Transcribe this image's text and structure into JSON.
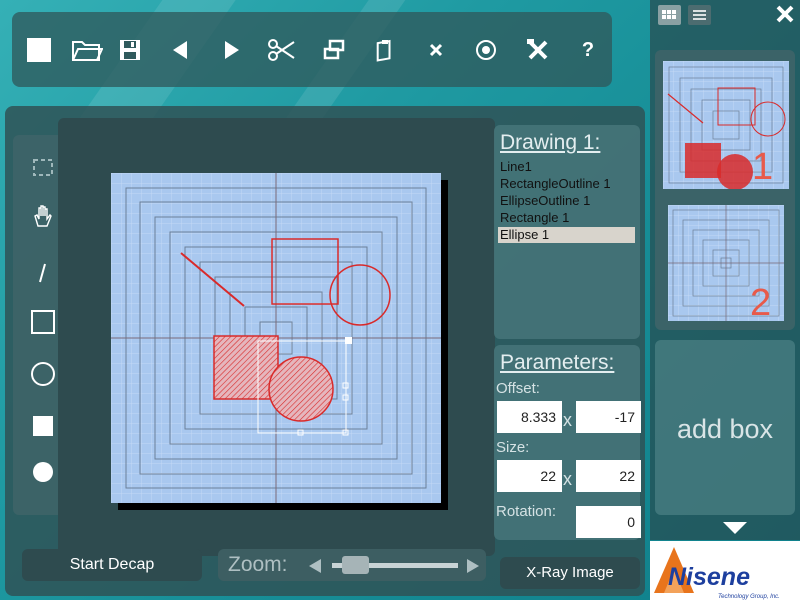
{
  "toolbar": {
    "icons": [
      "new-icon",
      "open-folder-icon",
      "save-icon",
      "undo-icon",
      "redo-icon",
      "cut-icon",
      "copy-icon",
      "paste-icon",
      "delete-icon",
      "target-icon",
      "tools-icon",
      "help-icon"
    ],
    "help_label": "?"
  },
  "tools": [
    "marquee-select-icon",
    "hand-pan-icon",
    "line-tool-icon",
    "rectangle-outline-icon",
    "ellipse-outline-icon",
    "filled-rectangle-icon",
    "filled-ellipse-icon"
  ],
  "drawing": {
    "heading": "Drawing 1:",
    "layers": [
      "Line1",
      "RectangleOutline 1",
      "EllipseOutline 1",
      "Rectangle 1",
      "Ellipse 1"
    ],
    "selected_index": 4
  },
  "parameters": {
    "heading": "Parameters:",
    "offset_label": "Offset:",
    "offset_x": "8.333",
    "offset_y": "-17",
    "x_sep": "x",
    "size_label": "Size:",
    "size_w": "22",
    "size_h": "22",
    "rotation_label": "Rotation:",
    "rotation": "0"
  },
  "bottom": {
    "start_decap": "Start Decap",
    "zoom_label": "Zoom:",
    "zoom_level": 0.1,
    "xray": "X-Ray Image"
  },
  "pages": {
    "thumb1_number": "1",
    "thumb2_number": "2",
    "add_box": "add box"
  },
  "logo": {
    "name": "Nisene",
    "tagline": "Technology Group, Inc."
  },
  "colors": {
    "accent_red": "#d92a2a",
    "canvas_blue": "#a9c8ef",
    "grid_line": "#8aa8cc",
    "logo_orange": "#e8741c",
    "logo_blue": "#1d3f9e"
  }
}
